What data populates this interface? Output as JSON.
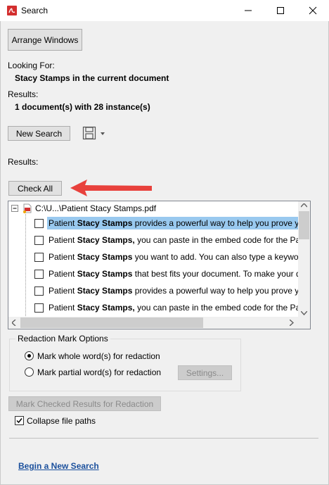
{
  "window": {
    "title": "Search"
  },
  "toolbar": {
    "arrange_label": "Arrange Windows"
  },
  "search": {
    "looking_for_label": "Looking For:",
    "looking_for_value": "Stacy Stamps in the current document",
    "results_label": "Results:",
    "results_value": "1 document(s) with 28 instance(s)",
    "new_search_label": "New Search"
  },
  "results": {
    "label": "Results:",
    "check_all_label": "Check All",
    "file_node": "C:\\U...\\Patient Stacy Stamps.pdf",
    "rows": [
      {
        "pre": "Patient ",
        "match": "Stacy Stamps",
        "post": " provides a powerful way to help you prove your",
        "selected": true
      },
      {
        "pre": "Patient ",
        "match": "Stacy Stamps,",
        "post": " you can paste in the embed code for the Patien",
        "selected": false
      },
      {
        "pre": "Patient ",
        "match": "Stacy Stamps",
        "post": " you want to add. You can also type a keyword to",
        "selected": false
      },
      {
        "pre": "Patient ",
        "match": "Stacy Stamps",
        "post": " that best fits your document. To make your doc",
        "selected": false
      },
      {
        "pre": "Patient ",
        "match": "Stacy Stamps",
        "post": " provides a powerful way to help you prove your",
        "selected": false
      },
      {
        "pre": "Patient ",
        "match": "Stacy Stamps,",
        "post": " you can paste in the embed code for the Patien",
        "selected": false
      }
    ]
  },
  "redaction": {
    "group_label": "Redaction Mark Options",
    "whole_label": "Mark whole word(s) for redaction",
    "partial_label": "Mark partial word(s) for redaction",
    "settings_label": "Settings...",
    "mark_checked_label": "Mark Checked Results for Redaction",
    "collapse_label": "Collapse file paths"
  },
  "footer": {
    "new_search_link": "Begin a New Search"
  },
  "colors": {
    "selection": "#99c9ef",
    "arrow": "#e8413c",
    "link": "#1a4f9c",
    "pdf_red": "#d32f2f"
  }
}
